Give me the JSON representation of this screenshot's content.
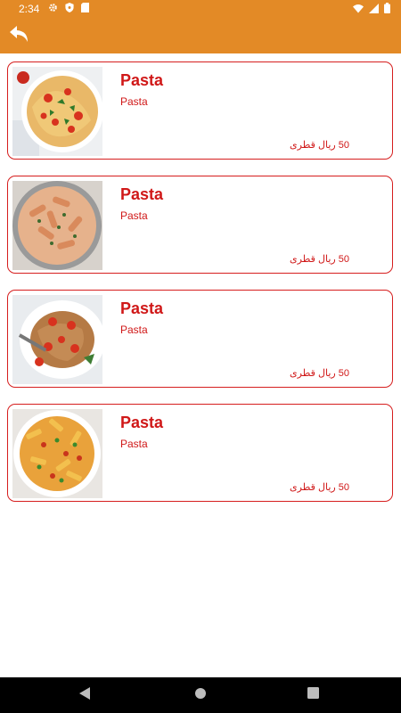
{
  "status_bar": {
    "time": "2:34",
    "icons_left": [
      "gear-icon",
      "shield-icon",
      "sd-card-icon"
    ],
    "icons_right": [
      "wifi-icon",
      "signal-icon",
      "battery-icon"
    ]
  },
  "app_bar": {
    "back_icon": "reply-back-icon",
    "color": "#E38A26"
  },
  "items": [
    {
      "title": "Pasta",
      "subtitle": "Pasta",
      "price": "50 ريال قطرى",
      "image": "spaghetti-tomato-basil"
    },
    {
      "title": "Pasta",
      "subtitle": "Pasta",
      "price": "50 ريال قطرى",
      "image": "penne-creamy"
    },
    {
      "title": "Pasta",
      "subtitle": "Pasta",
      "price": "50 ريال قطرى",
      "image": "spaghetti-cherry-tomato"
    },
    {
      "title": "Pasta",
      "subtitle": "Pasta",
      "price": "50 ريال قطرى",
      "image": "penne-vegetable"
    }
  ],
  "colors": {
    "accent": "#E38A26",
    "text": "#D01818",
    "border": "#D61E1E"
  },
  "nav_bar": {
    "buttons": [
      "back-triangle-icon",
      "home-circle-icon",
      "recents-square-icon"
    ]
  }
}
